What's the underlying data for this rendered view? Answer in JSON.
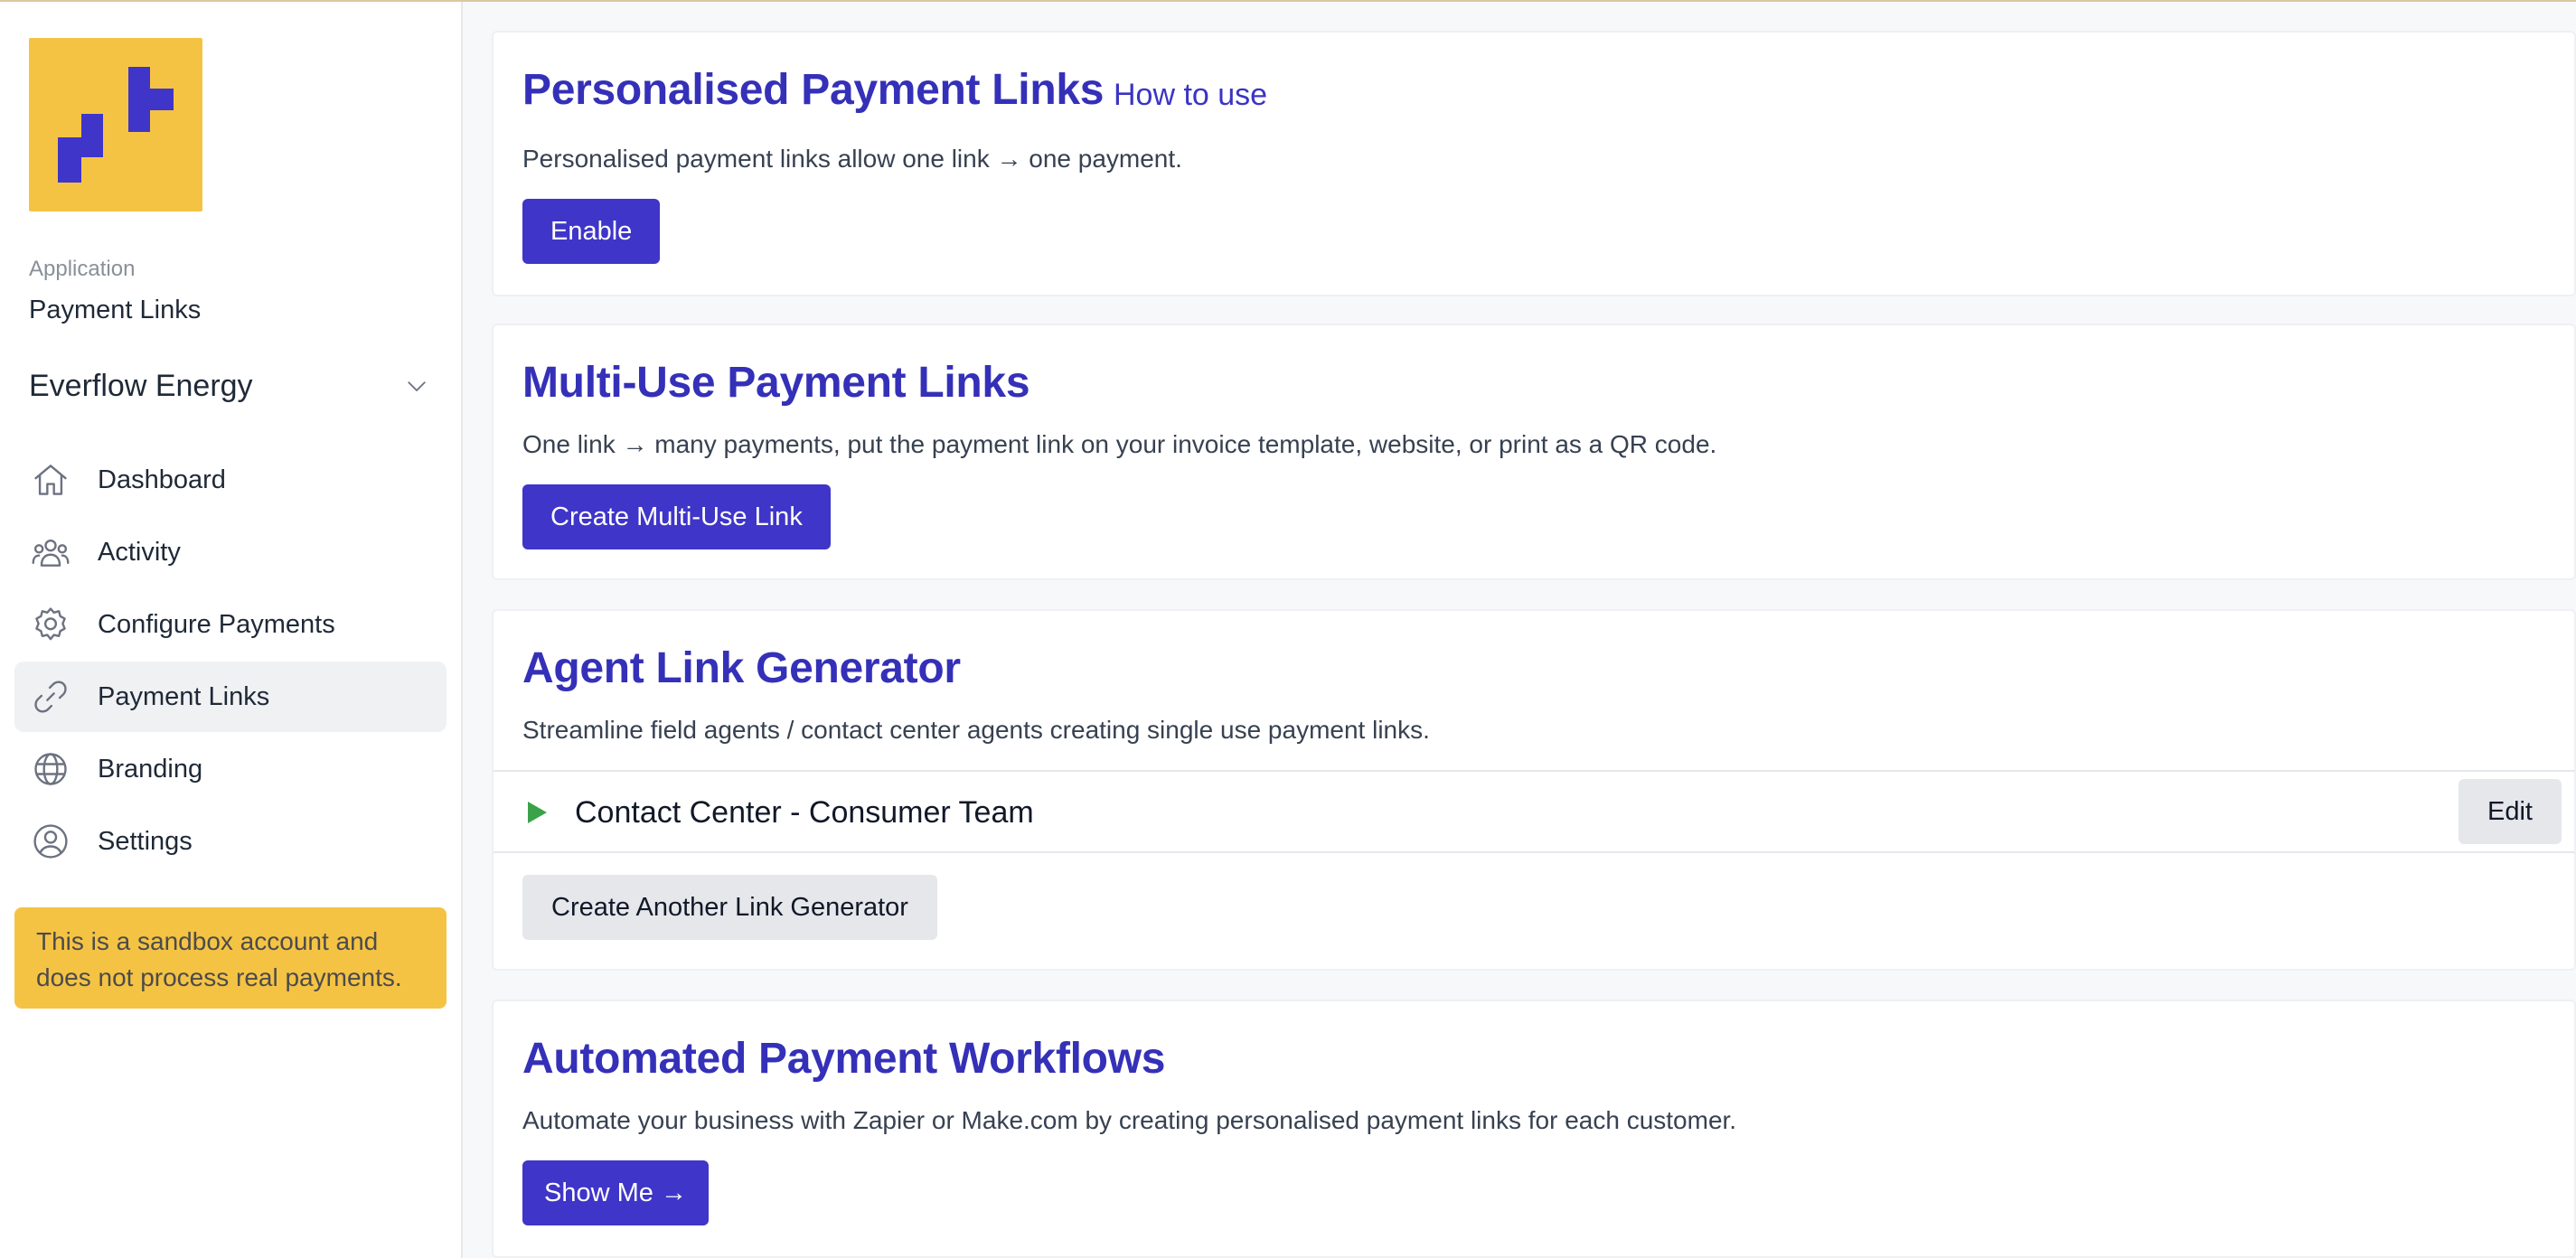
{
  "sidebar": {
    "app_caption": "Application",
    "app_name": "Payment Links",
    "org_name": "Everflow Energy",
    "items": [
      {
        "label": "Dashboard",
        "icon": "home-icon"
      },
      {
        "label": "Activity",
        "icon": "users-icon"
      },
      {
        "label": "Configure Payments",
        "icon": "gear-icon"
      },
      {
        "label": "Payment Links",
        "icon": "link-icon",
        "active": true
      },
      {
        "label": "Branding",
        "icon": "globe-icon"
      },
      {
        "label": "Settings",
        "icon": "user-circle-icon"
      }
    ],
    "sandbox_notice": "This is a sandbox account and does not process real payments."
  },
  "main": {
    "personalised": {
      "title": "Personalised Payment Links",
      "how_to_link": "How to use",
      "description": "Personalised payment links allow one link → one payment.",
      "button": "Enable"
    },
    "multi_use": {
      "title": "Multi-Use Payment Links",
      "description": "One link → many payments, put the payment link on your invoice template, website, or print as a QR code.",
      "button": "Create Multi-Use Link"
    },
    "agent_generator": {
      "title": "Agent Link Generator",
      "description": "Streamline field agents / contact center agents creating single use payment links.",
      "generators": [
        {
          "name": "Contact Center - Consumer Team",
          "edit_label": "Edit"
        }
      ],
      "create_button": "Create Another Link Generator"
    },
    "workflows": {
      "title": "Automated Payment Workflows",
      "description": "Automate your business with Zapier or Make.com by creating personalised payment links for each customer.",
      "button": "Show Me →"
    }
  },
  "colors": {
    "accent": "#3f35c8",
    "title": "#3530b8",
    "brand_yellow": "#f5c344",
    "play_green": "#3aa34a"
  }
}
